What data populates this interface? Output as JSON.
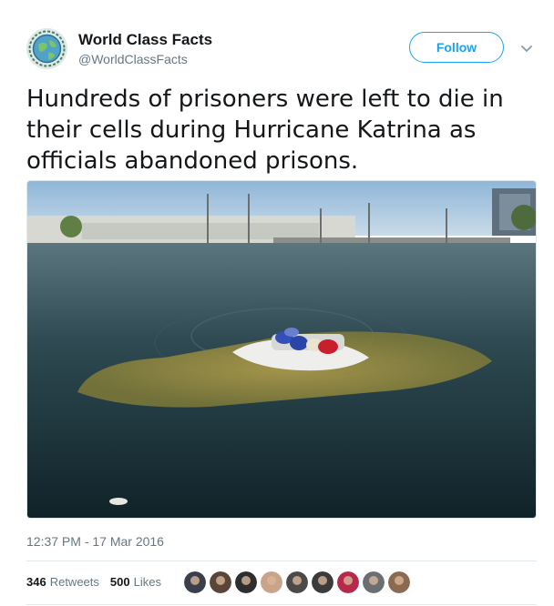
{
  "account": {
    "name": "World Class Facts",
    "handle": "@WorldClassFacts"
  },
  "actions": {
    "follow_label": "Follow"
  },
  "tweet": {
    "text": "Hundreds of prisoners were left to die in their cells during Hurricane Katrina as officials abandoned prisons.",
    "timestamp": "12:37 PM - 17 Mar 2016"
  },
  "stats": {
    "retweets_count": "346",
    "retweets_label": "Retweets",
    "likes_count": "500",
    "likes_label": "Likes"
  },
  "likers": [
    {
      "icon": "user-avatar-icon",
      "color": "#3a3f4b"
    },
    {
      "icon": "user-avatar-icon",
      "color": "#5a4638"
    },
    {
      "icon": "user-avatar-icon",
      "color": "#2e2e2e"
    },
    {
      "icon": "user-avatar-icon",
      "color": "#c9a48a"
    },
    {
      "icon": "user-avatar-icon",
      "color": "#4a4a4a"
    },
    {
      "icon": "user-avatar-icon",
      "color": "#3b3b3b"
    },
    {
      "icon": "user-avatar-icon",
      "color": "#b5294a"
    },
    {
      "icon": "user-avatar-icon",
      "color": "#6b6f74"
    },
    {
      "icon": "user-avatar-icon",
      "color": "#8a6b52"
    }
  ],
  "colors": {
    "accent": "#1da1f2",
    "text": "#14171a",
    "muted": "#657786"
  }
}
